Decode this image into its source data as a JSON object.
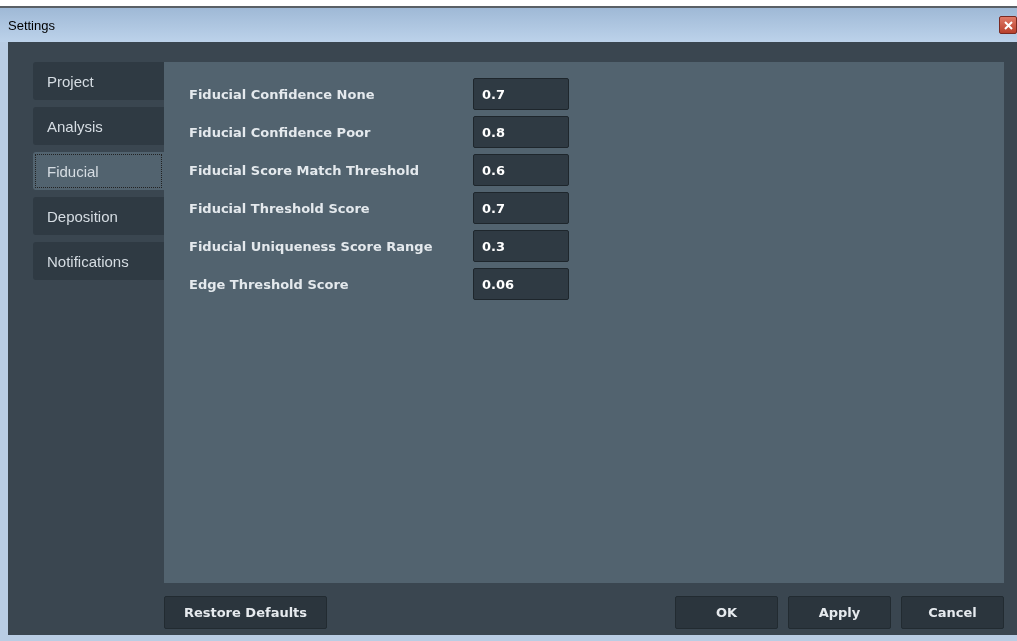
{
  "window": {
    "title": "Settings"
  },
  "tabs": [
    {
      "label": "Project",
      "selected": false
    },
    {
      "label": "Analysis",
      "selected": false
    },
    {
      "label": "Fiducial",
      "selected": true
    },
    {
      "label": "Deposition",
      "selected": false
    },
    {
      "label": "Notifications",
      "selected": false
    }
  ],
  "settings": [
    {
      "label": "Fiducial Confidence None",
      "value": "0.7"
    },
    {
      "label": "Fiducial Confidence Poor",
      "value": "0.8"
    },
    {
      "label": "Fiducial Score Match Threshold",
      "value": "0.6"
    },
    {
      "label": "Fiducial Threshold Score",
      "value": "0.7"
    },
    {
      "label": "Fiducial Uniqueness Score Range",
      "value": "0.3"
    },
    {
      "label": "Edge Threshold Score",
      "value": "0.06"
    }
  ],
  "buttons": {
    "left": [
      "Restore Defaults"
    ],
    "right": [
      "OK",
      "Apply",
      "Cancel"
    ]
  }
}
